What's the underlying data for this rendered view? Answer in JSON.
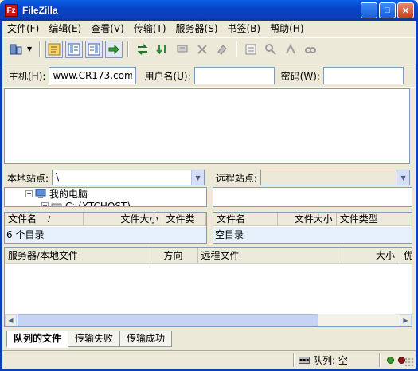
{
  "window": {
    "title": "FileZilla",
    "app_icon_glyph": "Fz"
  },
  "menu": [
    "文件(F)",
    "编辑(E)",
    "查看(V)",
    "传输(T)",
    "服务器(S)",
    "书签(B)",
    "帮助(H)"
  ],
  "quickconnect": {
    "host_label": "主机(H):",
    "host_value": "www.CR173.com",
    "user_label": "用户名(U):",
    "user_value": "",
    "password_label": "密码(W):",
    "password_value": ""
  },
  "local": {
    "site_label": "本地站点:",
    "site_value": "\\",
    "tree": [
      {
        "label": "我的电脑",
        "expander": "⊟"
      },
      {
        "label": "C: (XTCHOST)",
        "expander": "+"
      }
    ],
    "columns": [
      "文件名",
      "/",
      "文件大小",
      "文件类"
    ],
    "status": "6 个目录"
  },
  "remote": {
    "site_label": "远程站点:",
    "site_value": "",
    "columns": [
      "文件名",
      "文件大小",
      "文件类型"
    ],
    "status": "空目录"
  },
  "queue": {
    "columns": [
      "服务器/本地文件",
      "方向",
      "远程文件",
      "大小",
      "优"
    ],
    "tabs": [
      "队列的文件",
      "传输失败",
      "传输成功"
    ],
    "active_tab": "队列的文件"
  },
  "statusbar": {
    "queue_text": "队列: 空",
    "led_colors": [
      "#3a9a2c",
      "#8b1a1a"
    ]
  },
  "colors": {
    "titlebar": "#0a4fd6",
    "window_bg": "#ece9d8",
    "list_status_bg": "#e6f1fb"
  }
}
